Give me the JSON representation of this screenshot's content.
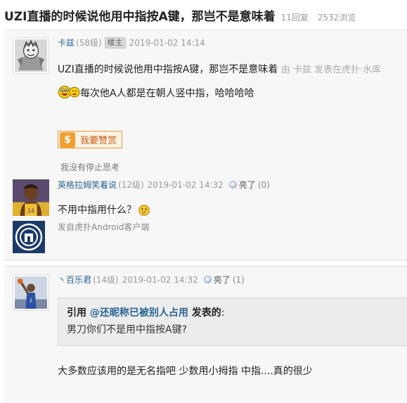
{
  "thread": {
    "title": "UZI直播的时候说他用中指按A键，那岂不是意味着",
    "replies": "11回复",
    "views": "2532浏览"
  },
  "posts": [
    {
      "author": "卡兹",
      "level": "(58级)",
      "op_badge": "楼主",
      "time": "2019-01-02 14:14",
      "title_line": "UZI直播的时候说他用中指按A键，那岂不是意味着",
      "source_suffix": "由 卡兹 发表在虎扑·水库",
      "body": "每次他A人都是在朝人竖中指，哈哈哈哈",
      "reward_label": "我要赞赏",
      "reward_icon": "$",
      "signature": "我没有停止思考",
      "avatar_icon": "avatar-icon",
      "emoji_icon": "grinning-emoji-icon"
    },
    {
      "author": "英格拉姆笑着说",
      "level": "(12级)",
      "time": "2019-01-02 14:32",
      "light_label": "亮了",
      "light_count": "(0)",
      "body": "不用中指用什么？",
      "client": "发自虎扑Android客户端",
      "avatar_icon": "avatar-icon",
      "emoji_icon": "thinking-emoji-icon"
    },
    {
      "author": "丶百乐君",
      "level": "(14级)",
      "time": "2019-01-02 14:32",
      "light_label": "亮了",
      "light_count": "(1)",
      "quote_prefix": "引用",
      "quote_user": "@还昵称已被别人占用",
      "quote_suffix": "发表的",
      "quote_colon": ":",
      "quote_text": "男刀你们不是用中指按A键?",
      "body": "大多数应该用的是无名指吧 少数用小拇指 中指....真的很少",
      "avatar_icon": "avatar-icon"
    }
  ],
  "colors": {
    "link": "#2a6496",
    "post_bg": "#f7f7f7",
    "quote_bg": "#ececec",
    "reward_orange": "#e8963a"
  }
}
